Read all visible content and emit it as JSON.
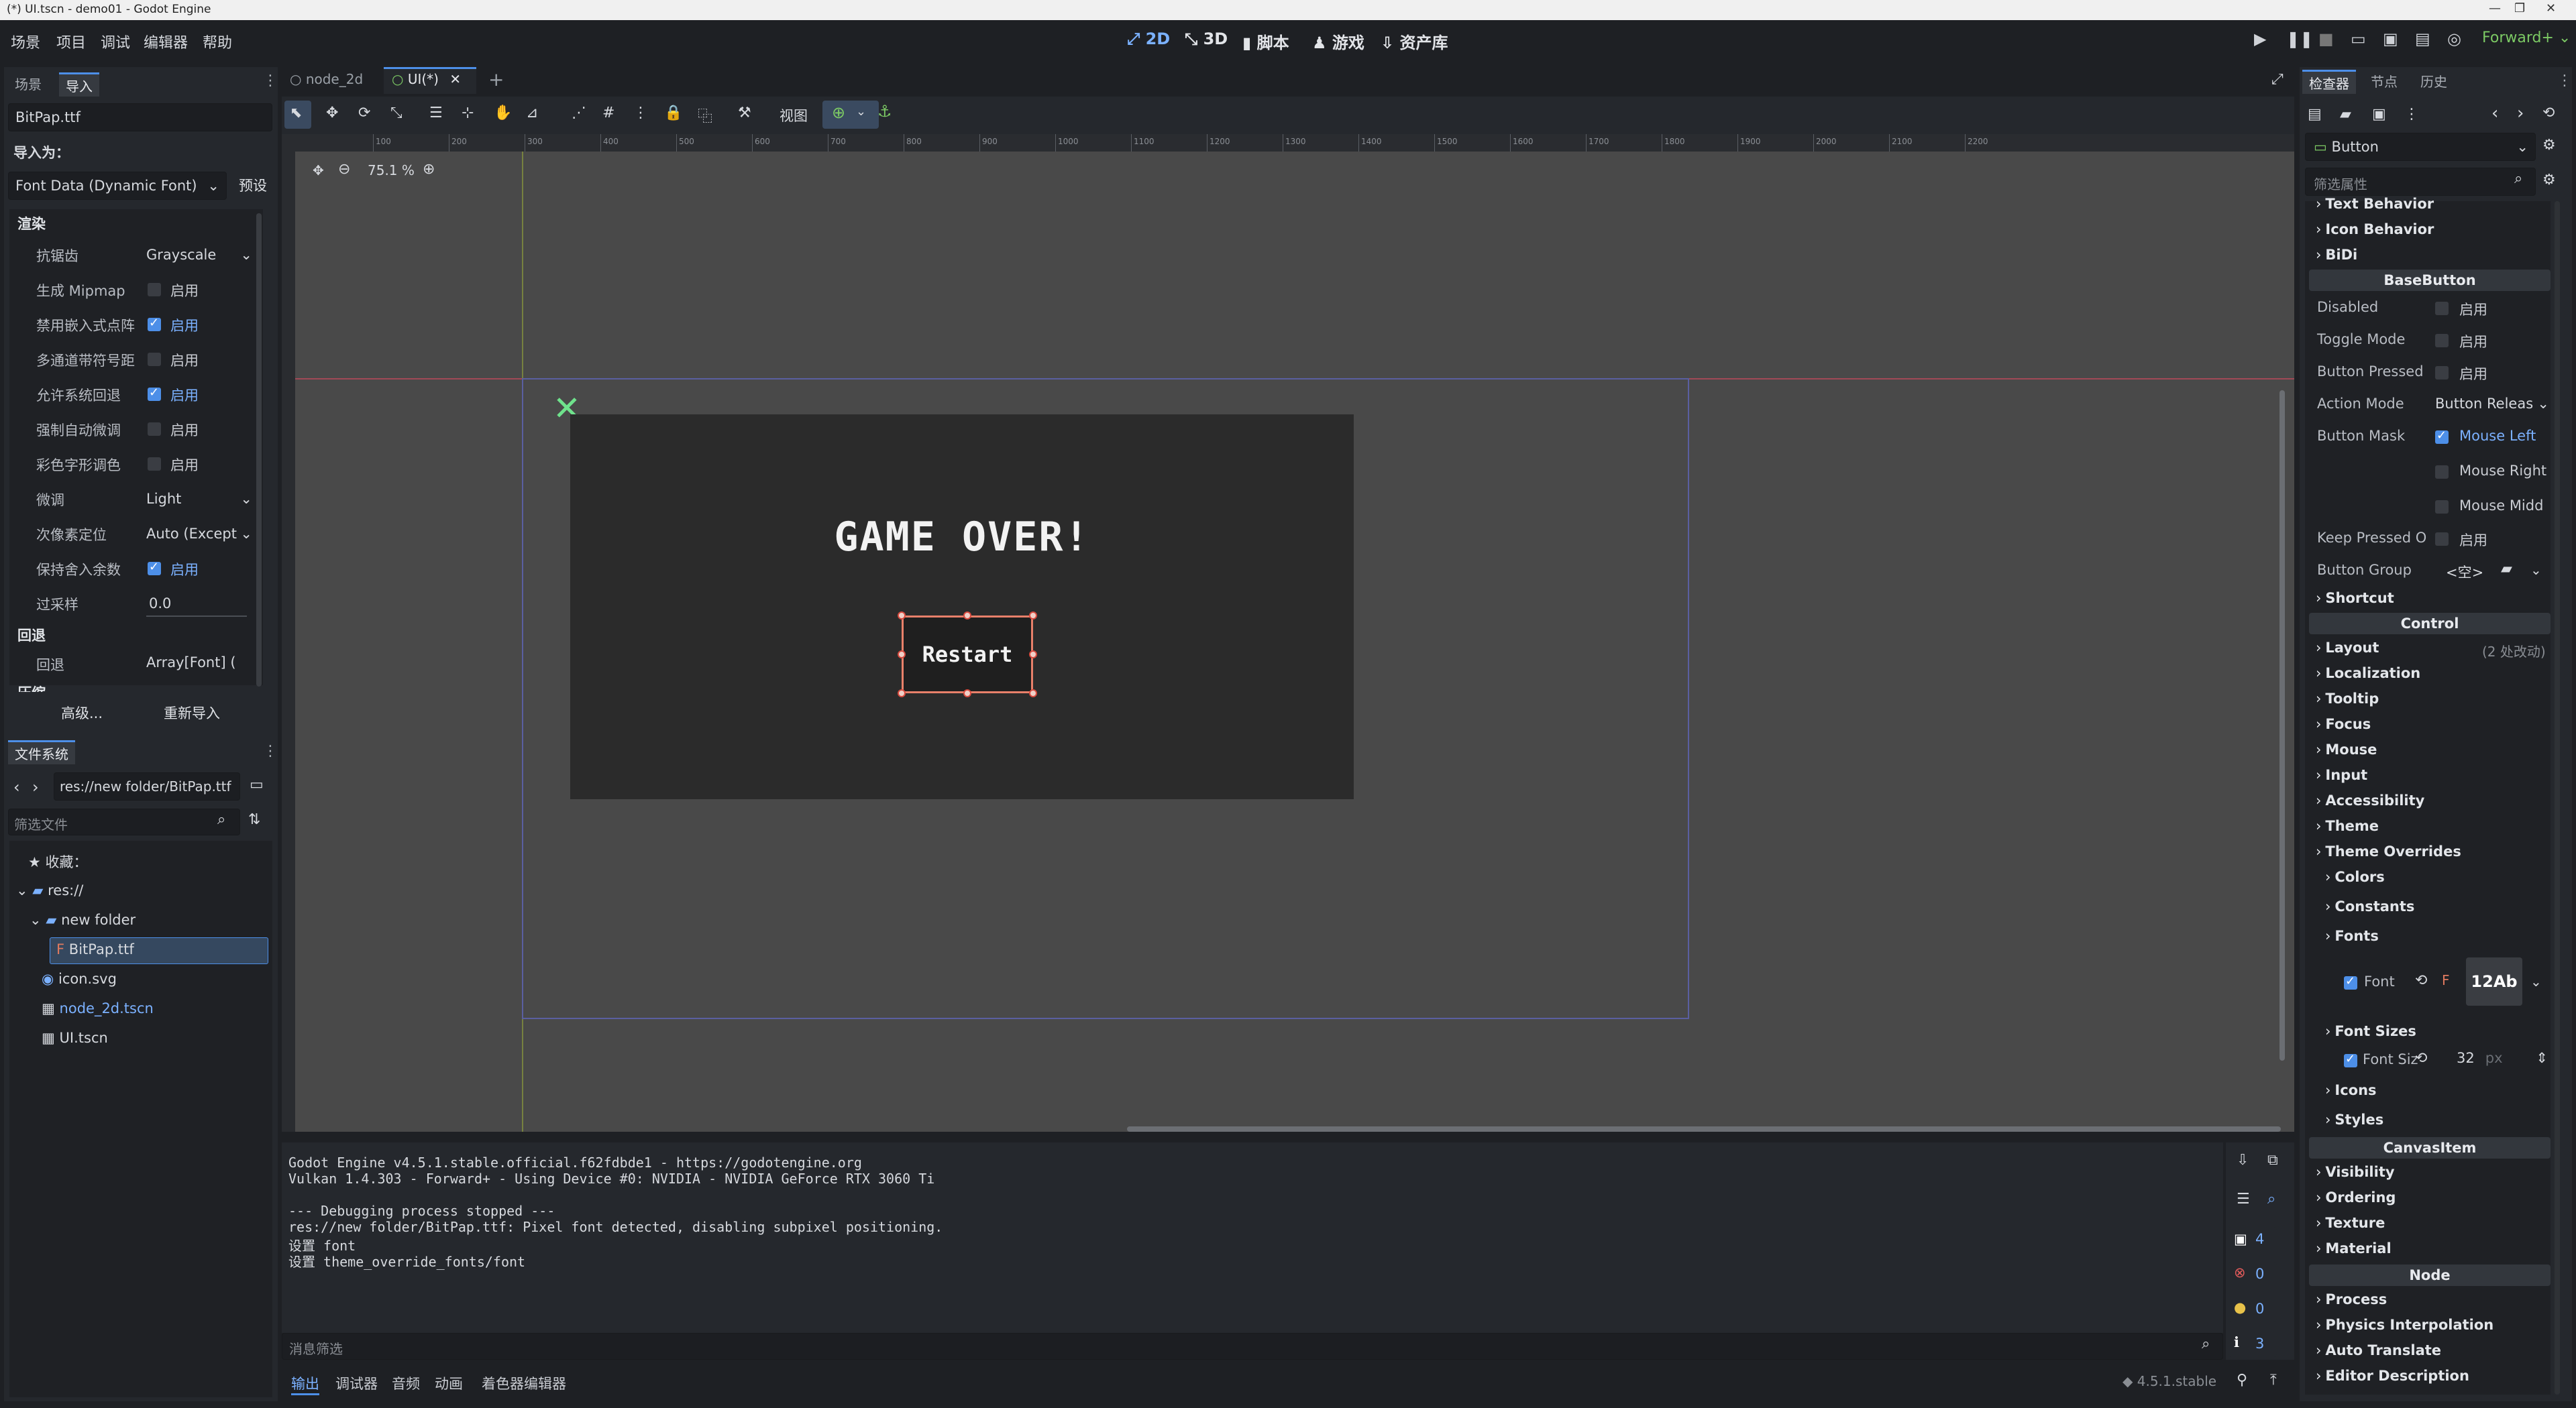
{
  "window": {
    "title": "(*) UI.tscn - demo01 - Godot Engine"
  },
  "menu": [
    "场景",
    "项目",
    "调试",
    "编辑器",
    "帮助"
  ],
  "workspaces": [
    {
      "label": "2D",
      "icon": "2d-icon",
      "active": true
    },
    {
      "label": "3D",
      "icon": "3d-icon",
      "active": false
    },
    {
      "label": "脚本",
      "icon": "script-icon",
      "active": false
    },
    {
      "label": "游戏",
      "icon": "game-icon",
      "active": false
    },
    {
      "label": "资产库",
      "icon": "assetlib-icon",
      "active": false
    }
  ],
  "renderer": "Forward+",
  "left_dock": {
    "tabs": [
      "场景",
      "导入"
    ],
    "file_name": "BitPap.ttf",
    "import_as_label": "导入为：",
    "import_as_value": "Font Data (Dynamic Font)",
    "preset_label": "预设",
    "rendering_header": "渲染",
    "rows": [
      {
        "label": "抗锯齿",
        "type": "select",
        "value": "Grayscale"
      },
      {
        "label": "生成 Mipmap",
        "type": "check",
        "checked": false,
        "text": "启用"
      },
      {
        "label": "禁用嵌入式点阵",
        "type": "check",
        "checked": true,
        "text": "启用"
      },
      {
        "label": "多通道带符号距",
        "type": "check",
        "checked": false,
        "text": "启用"
      },
      {
        "label": "允许系统回退",
        "type": "check",
        "checked": true,
        "text": "启用"
      },
      {
        "label": "强制自动微调",
        "type": "check",
        "checked": false,
        "text": "启用"
      },
      {
        "label": "彩色字形调色",
        "type": "check",
        "checked": false,
        "text": "启用"
      },
      {
        "label": "微调",
        "type": "select",
        "value": "Light"
      },
      {
        "label": "次像素定位",
        "type": "select",
        "value": "Auto (Except"
      },
      {
        "label": "保持舍入余数",
        "type": "check",
        "checked": true,
        "text": "启用"
      },
      {
        "label": "过采样",
        "type": "number",
        "value": "0.0"
      }
    ],
    "fallback_header": "回退",
    "fallback_label": "回退",
    "fallback_value": "Array[Font] (",
    "compress_header": "压缩",
    "advanced_btn": "高级...",
    "reimport_btn": "重新导入"
  },
  "filesystem": {
    "title": "文件系统",
    "path": "res://new folder/BitPap.ttf",
    "filter_placeholder": "筛选文件",
    "favorites": "收藏：",
    "items": [
      {
        "label": "res://",
        "icon": "folder-icon"
      },
      {
        "label": "new folder",
        "icon": "folder-icon"
      },
      {
        "label": "BitPap.ttf",
        "icon": "font-file-icon"
      },
      {
        "label": "icon.svg",
        "icon": "svg-file-icon"
      },
      {
        "label": "node_2d.tscn",
        "icon": "scene-icon"
      },
      {
        "label": "UI.tscn",
        "icon": "scene-icon"
      }
    ]
  },
  "editor_tabs": [
    {
      "label": "node_2d",
      "active": false
    },
    {
      "label": "UI(*)",
      "active": true
    }
  ],
  "toolbar": {
    "view_label": "视图"
  },
  "viewport": {
    "zoom": "75.1 %",
    "ruler_ticks": [
      "100",
      "200",
      "300",
      "400",
      "500",
      "600",
      "700",
      "800",
      "900",
      "1000",
      "1100",
      "1200",
      "1300",
      "1400",
      "1500",
      "1600",
      "1700",
      "1800",
      "1900",
      "2000",
      "2100",
      "2200"
    ],
    "game_over_text": "GAME OVER!",
    "restart_text": "Restart"
  },
  "console": {
    "lines": [
      "Godot Engine v4.5.1.stable.official.f62fdbde1 - https://godotengine.org",
      "Vulkan 1.4.303 - Forward+ - Using Device #0: NVIDIA - NVIDIA GeForce RTX 3060 Ti",
      "",
      "--- Debugging process stopped ---",
      "res://new folder/BitPap.ttf: Pixel font detected, disabling subpixel positioning.",
      "设置 font",
      "设置 theme_override_fonts/font"
    ],
    "filter_placeholder": "消息筛选",
    "counters": [
      "4",
      "0",
      "0",
      "3"
    ]
  },
  "bottom_tabs": [
    "输出",
    "调试器",
    "音频",
    "动画",
    "着色器编辑器"
  ],
  "version": "4.5.1.stable",
  "inspector": {
    "tabs": [
      "检查器",
      "节点",
      "历史"
    ],
    "node_type": "Button",
    "filter_placeholder": "筛选属性",
    "top_categories": [
      "Text Behavior",
      "Icon Behavior",
      "BiDi"
    ],
    "base_button_header": "BaseButton",
    "base_button_rows": [
      {
        "label": "Disabled",
        "type": "check",
        "checked": false,
        "text": "启用"
      },
      {
        "label": "Toggle Mode",
        "type": "check",
        "checked": false,
        "text": "启用"
      },
      {
        "label": "Button Pressed",
        "type": "check",
        "checked": false,
        "text": "启用"
      },
      {
        "label": "Action Mode",
        "type": "select",
        "value": "Button Releas"
      },
      {
        "label": "Button Mask",
        "type": "check",
        "checked": true,
        "text": "Mouse Left"
      },
      {
        "label": "",
        "type": "check",
        "checked": false,
        "text": "Mouse Right"
      },
      {
        "label": "",
        "type": "check",
        "checked": false,
        "text": "Mouse Midd"
      },
      {
        "label": "Keep Pressed O",
        "type": "check",
        "checked": false,
        "text": "启用"
      },
      {
        "label": "Button Group",
        "type": "value",
        "value": "<空>"
      }
    ],
    "shortcut": "Shortcut",
    "control_header": "Control",
    "control_categories": [
      "Layout",
      "Localization",
      "Tooltip",
      "Focus",
      "Mouse",
      "Input",
      "Accessibility",
      "Theme",
      "Theme Overrides"
    ],
    "layout_note": "(2 处改动)",
    "theme_overrides": {
      "colors": "Colors",
      "constants": "Constants",
      "fonts": "Fonts",
      "font_label": "Font",
      "font_preview": "12Ab",
      "font_sizes": "Font Sizes",
      "font_size_label": "Font Siz",
      "font_size_value": "32",
      "font_size_unit": "px",
      "icons": "Icons",
      "styles": "Styles"
    },
    "canvas_header": "CanvasItem",
    "canvas_categories": [
      "Visibility",
      "Ordering",
      "Texture",
      "Material"
    ],
    "node_header": "Node",
    "node_categories": [
      "Process",
      "Physics Interpolation",
      "Auto Translate",
      "Editor Description"
    ]
  }
}
